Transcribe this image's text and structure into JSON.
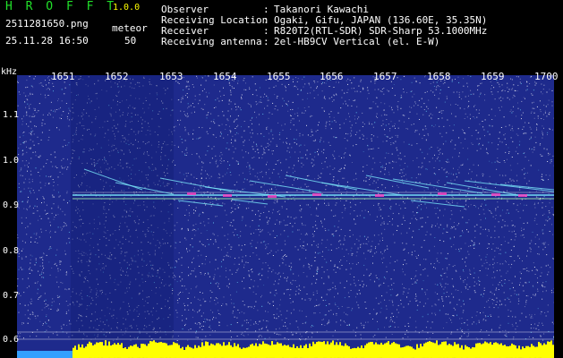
{
  "header": {
    "app_title": "H R O F F T",
    "version": "1.0.0",
    "filename": "2511281650.png",
    "datetime": "25.11.28 16:50",
    "meteor_label": "meteor",
    "meteor_count": "50",
    "info": [
      {
        "label": "Observer",
        "value": "Takanori Kawachi"
      },
      {
        "label": "Receiving Location",
        "value": "Ogaki, Gifu, JAPAN (136.60E, 35.35N)"
      },
      {
        "label": "Receiver",
        "value": "R820T2(RTL-SDR) SDR-Sharp 53.1000MHz"
      },
      {
        "label": "Receiving antenna",
        "value": "2el-HB9CV Vertical (el. E-W)"
      }
    ]
  },
  "spectrogram": {
    "y_unit": "kHz",
    "x_ticks": [
      "1651",
      "1652",
      "1653",
      "1654",
      "1655",
      "1656",
      "1657",
      "1658",
      "1659",
      "1700"
    ],
    "y_ticks": [
      "1.1",
      "1.0",
      "0.9",
      "0.8",
      "0.7",
      "0.6"
    ],
    "background_color": "#1e2a8c",
    "noise_color": "#ffffff",
    "trace_color": "#7ff0ff",
    "power_bar_color": "#ffff00",
    "left_bar_color": "#33a0ff"
  }
}
